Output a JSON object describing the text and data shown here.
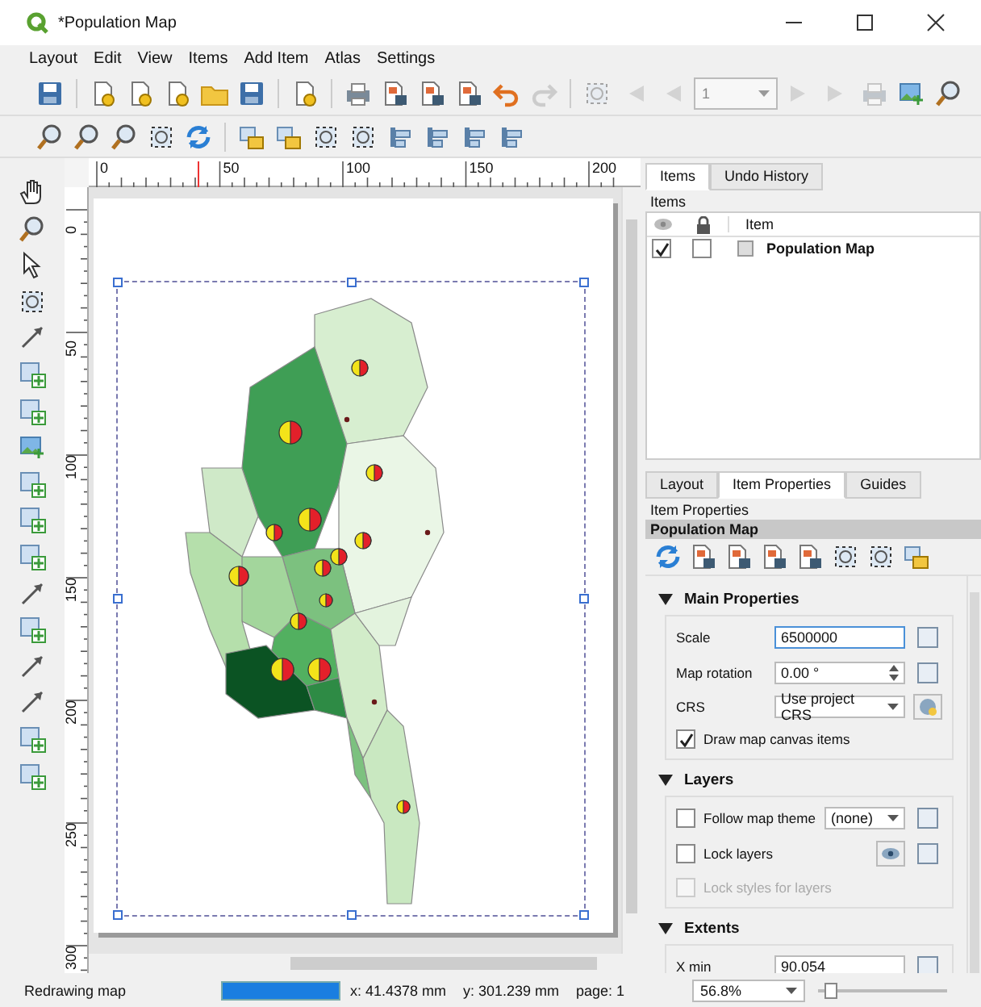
{
  "window": {
    "title": "*Population Map"
  },
  "menu": [
    "Layout",
    "Edit",
    "View",
    "Items",
    "Add Item",
    "Atlas",
    "Settings"
  ],
  "toolbar": {
    "page_field": "1"
  },
  "rulers": {
    "horizontal": [
      "0",
      "50",
      "100",
      "150",
      "200"
    ],
    "vertical": [
      "0",
      "50",
      "100",
      "150",
      "200",
      "250",
      "300"
    ]
  },
  "items_panel": {
    "tabs": [
      {
        "label": "Items",
        "selected": true
      },
      {
        "label": "Undo History",
        "selected": false
      }
    ],
    "title": "Items",
    "column": "Item",
    "rows": [
      {
        "label": "Population Map",
        "visible": true,
        "locked": false
      }
    ]
  },
  "properties_panel": {
    "tabs": [
      {
        "label": "Layout",
        "selected": false
      },
      {
        "label": "Item Properties",
        "selected": true
      },
      {
        "label": "Guides",
        "selected": false
      }
    ],
    "title": "Item Properties",
    "item": "Population Map",
    "sections": [
      {
        "title": "Main Properties",
        "expanded": true,
        "fields": [
          {
            "kind": "text",
            "label": "Scale",
            "value": "6500000"
          },
          {
            "kind": "spin",
            "label": "Map rotation",
            "value": "0.00 °"
          },
          {
            "kind": "combo",
            "label": "CRS",
            "value": "Use project CRS"
          },
          {
            "kind": "check",
            "label": "Draw map canvas items",
            "checked": true,
            "disabled": false
          }
        ]
      },
      {
        "title": "Layers",
        "expanded": true,
        "fields": [
          {
            "kind": "check-combo",
            "label": "Follow map theme",
            "checked": false,
            "value": "(none)"
          },
          {
            "kind": "check-button",
            "label": "Lock layers",
            "checked": false,
            "disabled": false
          },
          {
            "kind": "check",
            "label": "Lock styles for layers",
            "checked": false,
            "disabled": true
          }
        ]
      },
      {
        "title": "Extents",
        "expanded": true,
        "fields": [
          {
            "kind": "text",
            "label": "X min",
            "value": "90.054"
          }
        ]
      }
    ]
  },
  "status_bar": {
    "message": "Redrawing map",
    "progress": {
      "level": 1
    },
    "x": "x: 41.4378 mm",
    "y": "y: 301.239 mm",
    "page": "page: 1",
    "zoom": "56.8%",
    "zoom_slider": {
      "level": 0.05
    }
  }
}
